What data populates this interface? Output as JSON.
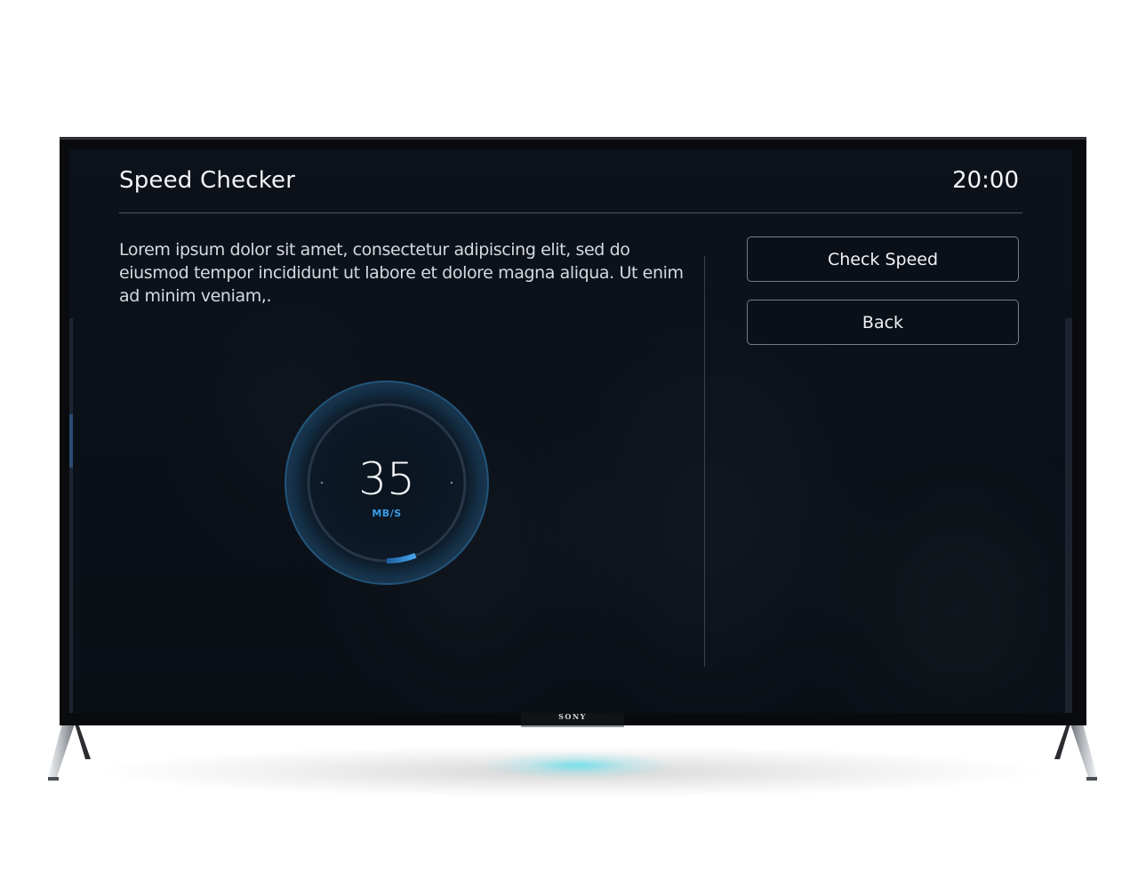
{
  "screen": {
    "title": "Speed Checker",
    "clock": "20:00",
    "description": "Lorem ipsum dolor sit amet, consectetur adipiscing elit, sed do eiusmod tempor incididunt ut labore et dolore magna aliqua. Ut enim ad minim veniam,.",
    "buttons": {
      "check_speed": "Check Speed",
      "back": "Back"
    }
  },
  "gauge": {
    "value": "35",
    "unit": "MB/S",
    "fill_fraction": 0.06
  },
  "device": {
    "brand": "SONY"
  },
  "colors": {
    "accent": "#3a9be6",
    "text": "#f2f4f7",
    "stand_glow": "#66e0eb"
  }
}
